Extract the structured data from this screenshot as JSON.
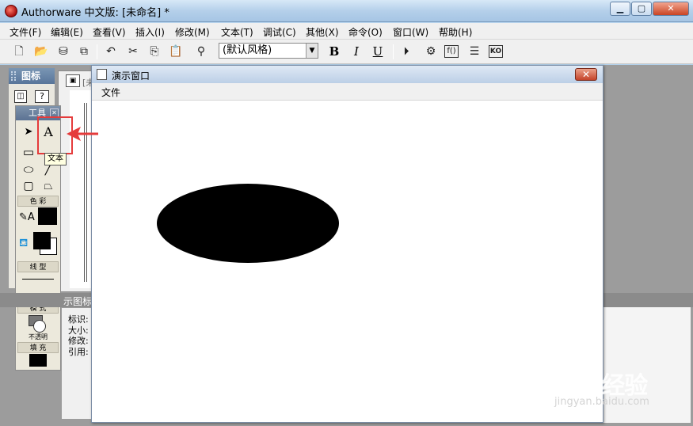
{
  "window": {
    "title": "Authorware 中文版: [未命名] *"
  },
  "menubar": [
    "文件(F)",
    "编辑(E)",
    "查看(V)",
    "插入(I)",
    "修改(M)",
    "文本(T)",
    "调试(C)",
    "其他(X)",
    "命令(O)",
    "窗口(W)",
    "帮助(H)"
  ],
  "toolbar": {
    "style_select": "(默认风格)",
    "bold": "B",
    "italic": "I",
    "underline": "U"
  },
  "icon_palette": {
    "title": "图标"
  },
  "flow_window": {
    "title_stub": "[未"
  },
  "tools_panel": {
    "title": "工具",
    "text_tool": "A",
    "tooltip": "文本",
    "sections": {
      "color": "色 彩",
      "line": "线 型",
      "mode": "模 式",
      "mode_value": "不透明",
      "fill": "填 充"
    }
  },
  "properties": {
    "strip_label": "示图标",
    "fields": [
      "标识:",
      "大小:",
      "修改:",
      "引用:"
    ]
  },
  "presentation": {
    "title": "演示窗口",
    "menu_file": "文件"
  },
  "watermark": {
    "brand": "Baidu经验",
    "url": "jingyan.baidu.com"
  },
  "colors": {
    "highlight": "#e53b3b",
    "ellipse": "#000000"
  }
}
